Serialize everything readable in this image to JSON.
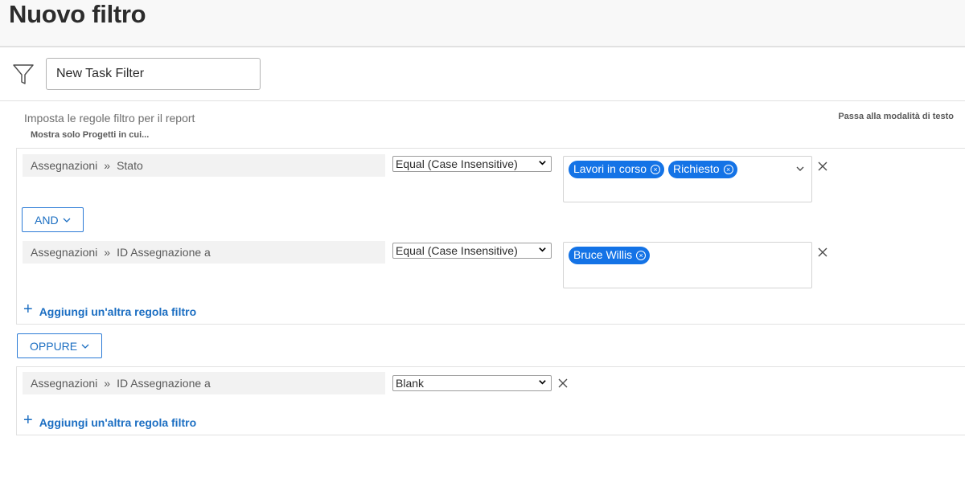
{
  "header": {
    "title": "Nuovo filtro"
  },
  "filter_name": {
    "value": "New Task Filter"
  },
  "intro": {
    "text": "Imposta le regole filtro per il report",
    "subtext": "Mostra solo Progetti in cui...",
    "text_mode_link": "Passa alla modalità di testo"
  },
  "groups": [
    {
      "rules": [
        {
          "field_path": [
            "Assegnazioni",
            "Stato"
          ],
          "operator": "Equal (Case Insensitive)",
          "values": [
            "Lavori in corso",
            "Richiesto"
          ]
        },
        {
          "field_path": [
            "Assegnazioni",
            "ID Assegnazione a"
          ],
          "operator": "Equal (Case Insensitive)",
          "values": [
            "Bruce Willis"
          ]
        }
      ],
      "conjunction": "AND",
      "add_rule_label": "Aggiungi un'altra regola filtro"
    },
    {
      "rules": [
        {
          "field_path": [
            "Assegnazioni",
            "ID Assegnazione a"
          ],
          "operator": "Blank",
          "values": []
        }
      ],
      "add_rule_label": "Aggiungi un'altra regola filtro"
    }
  ],
  "group_conjunction": "OPPURE",
  "colors": {
    "accent": "#1473e6",
    "link": "#1b6ec2",
    "field_bg": "#f2f2f2"
  }
}
